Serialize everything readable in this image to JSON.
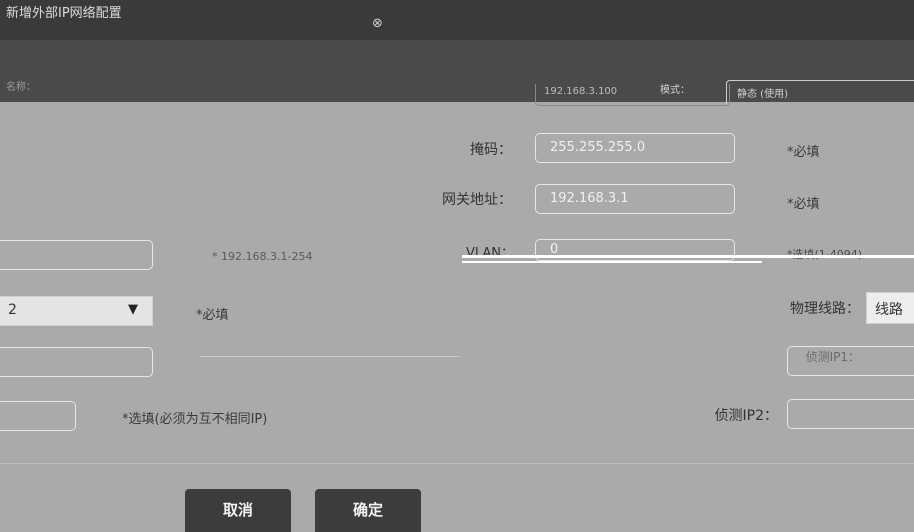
{
  "dialog": {
    "title": "新增外部IP网络配置",
    "close_label": "⊗"
  },
  "top_row": {
    "field_label": "名称：",
    "ip_value": "192.168.3.100",
    "mode_label": "模式：",
    "mode_value": "静态 (使用)"
  },
  "form": {
    "mask": {
      "label": "掩码：",
      "value": "255.255.255.0",
      "hint": "*必填"
    },
    "gateway": {
      "label": "网关地址：",
      "value": "192.168.3.1",
      "hint": "*必填"
    },
    "vlan": {
      "label": "VLAN：",
      "value": "0",
      "hint": "*选填(1-4094)"
    },
    "left_hint_row": "* 192.168.3.1-254",
    "interface": {
      "value": "2",
      "hint": "*必填"
    },
    "physical_line": {
      "label": "物理线路：",
      "value": "线路"
    },
    "probe_ip1": {
      "label": "侦测IP1："
    },
    "probe_ip2": {
      "label": "侦测IP2：",
      "value": ""
    },
    "probe_hint": "*选填(必须为互不相同IP)"
  },
  "buttons": {
    "cancel": "取消",
    "confirm": "确定"
  }
}
